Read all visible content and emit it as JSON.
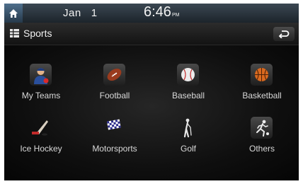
{
  "statusbar": {
    "month": "Jan",
    "day": "1",
    "time": "6:46",
    "ampm": "PM"
  },
  "titlebar": {
    "title": "Sports"
  },
  "categories": [
    {
      "label": "My Teams",
      "icon": "my-teams-icon"
    },
    {
      "label": "Football",
      "icon": "football-icon"
    },
    {
      "label": "Baseball",
      "icon": "baseball-icon"
    },
    {
      "label": "Basketball",
      "icon": "basketball-icon"
    },
    {
      "label": "Ice Hockey",
      "icon": "ice-hockey-icon"
    },
    {
      "label": "Motorsports",
      "icon": "checkered-flag-icon"
    },
    {
      "label": "Golf",
      "icon": "golfer-icon"
    },
    {
      "label": "Others",
      "icon": "runner-icon"
    }
  ]
}
